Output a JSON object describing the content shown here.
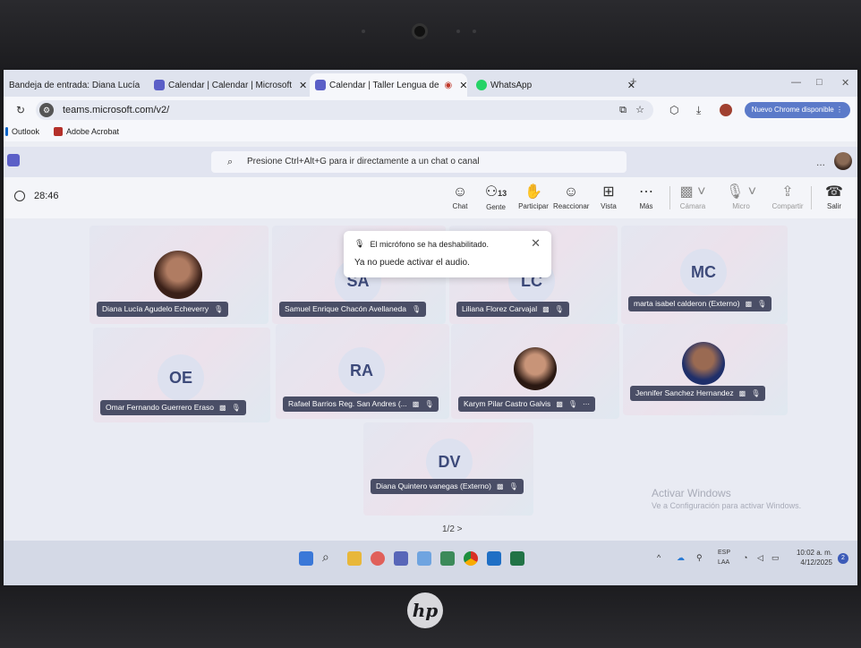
{
  "browser": {
    "tabs": [
      {
        "label": "Bandeja de entrada: Diana Lucía",
        "close": "✕"
      },
      {
        "label": "Calendar | Calendar | Microsoft",
        "close": "✕"
      },
      {
        "label": "Calendar | Taller Lengua de",
        "close": "✕"
      },
      {
        "label": "WhatsApp",
        "close": "✕"
      }
    ],
    "new_tab": "+",
    "url": "teams.microsoft.com/v2/",
    "update_label": "Nuevo Chrome disponible",
    "bookmarks": [
      "Outlook",
      "Adobe Acrobat"
    ]
  },
  "teams": {
    "search_placeholder": "Presione Ctrl+Alt+G para ir directamente a un chat o canal",
    "more": "..."
  },
  "meeting": {
    "timer": "28:46",
    "controls": {
      "chat": "Chat",
      "people": "Gente",
      "people_count": "13",
      "raise": "Participar",
      "react": "Reaccionar",
      "view": "Vista",
      "more": "Más",
      "camera": "Cámara",
      "mic": "Micro",
      "share": "Compartir",
      "leave": "Salir"
    }
  },
  "toast": {
    "title": "El micrófono se ha deshabilitado.",
    "body": "Ya no puede activar el audio.",
    "close": "✕"
  },
  "participants": [
    {
      "name": "Diana Lucía Agudelo Echeverry",
      "initials": ""
    },
    {
      "name": "Samuel Enrique Chacón Avellaneda",
      "initials": "SA"
    },
    {
      "name": "Liliana Florez Carvajal",
      "initials": "LC"
    },
    {
      "name": "marta isabel calderon (Externo)",
      "initials": "MC"
    },
    {
      "name": "Omar Fernando Guerrero Eraso",
      "initials": "OE"
    },
    {
      "name": "Rafael Barrios Reg. San Andres (...",
      "initials": "RA"
    },
    {
      "name": "Karym Pilar Castro Galvis",
      "initials": ""
    },
    {
      "name": "Jennifer Sanchez Hernandez",
      "initials": ""
    },
    {
      "name": "Diana Quintero vanegas (Externo)",
      "initials": "DV"
    }
  ],
  "pager": "1/2  >",
  "watermark": {
    "title": "Activar Windows",
    "subtitle": "Ve a Configuración para activar Windows."
  },
  "taskbar": {
    "lang": "ESP",
    "lang2": "LAA",
    "time": "10:02 a. m.",
    "date": "4/12/2025",
    "notif_count": "2"
  }
}
